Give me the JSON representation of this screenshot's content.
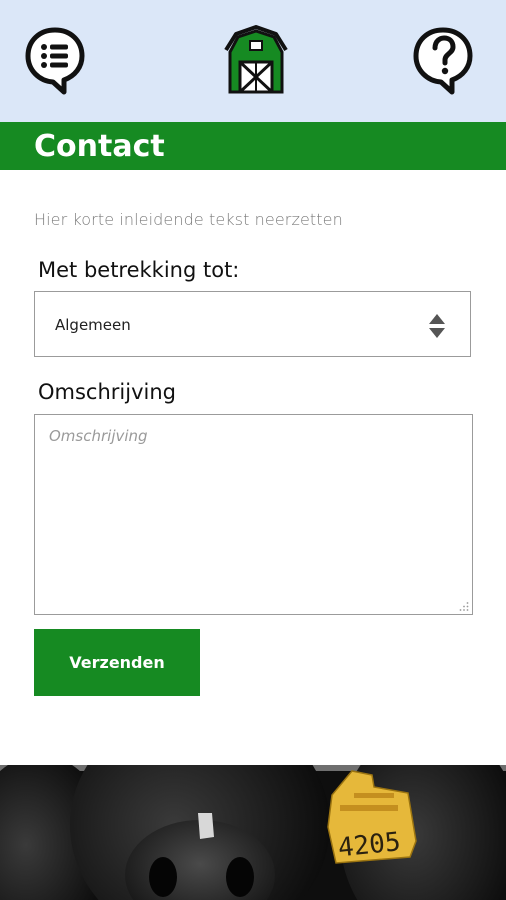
{
  "header": {
    "menu_icon": "menu-chat-icon",
    "home_icon": "barn-icon",
    "help_icon": "help-chat-icon"
  },
  "page": {
    "title": "Contact",
    "intro": "Hier korte inleidende tekst neerzetten"
  },
  "form": {
    "subject_label": "Met betrekking tot:",
    "subject_value": "Algemeen",
    "description_label": "Omschrijving",
    "description_placeholder": "Omschrijving",
    "submit_label": "Verzenden"
  },
  "photo": {
    "ear_tag_text": "4205"
  },
  "colors": {
    "brand_green": "#168a22",
    "header_bg": "#dbe7f8"
  }
}
